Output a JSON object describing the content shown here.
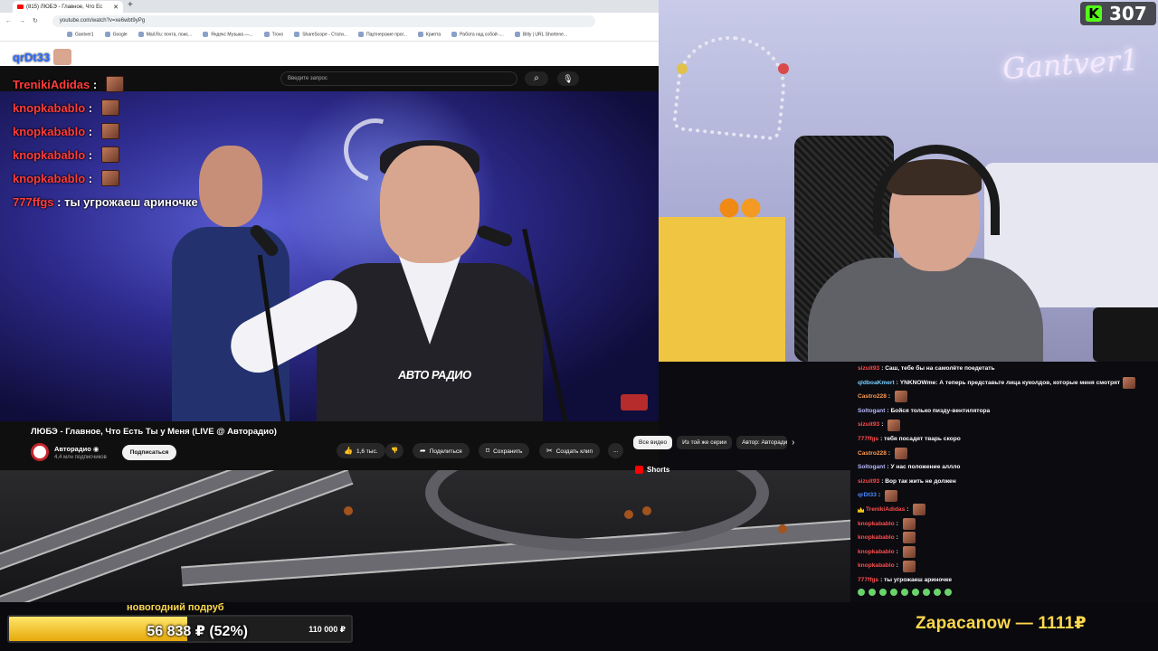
{
  "stream": {
    "viewer_count": "307",
    "streamer_neon_sign": "Gantver1"
  },
  "browser": {
    "tab_title": "(815) ЛЮБЭ - Главное, Что Ес",
    "url": "youtube.com/watch?v=xe6wbt9yPg",
    "bookmarks": [
      "Gantver1",
      "Google",
      "Mail.Ru: почта, поис...",
      "Яндекс Музыка —...",
      "Trovo",
      "ShareScope - Стати...",
      "Партнерские прог...",
      "Крипта",
      "Работа над собой -...",
      "Bitly | URL Shortene..."
    ]
  },
  "youtube": {
    "search_placeholder": "Введите запрос",
    "video_watermark": "АВТО РАДИО",
    "title": "ЛЮБЭ - Главное, Что Есть Ты у Меня (LIVE @ Авторадио)",
    "channel_name": "Авторадио",
    "channel_subs": "4,4 млн подписчиков",
    "subscribe": "Подписаться",
    "likes": "1,6 тыс.",
    "share": "Поделиться",
    "save": "Сохранить",
    "clip": "Создать клип",
    "more": "...",
    "chips": [
      "Все видео",
      "Из той же серии",
      "Автор: Авторадио"
    ],
    "shorts": "Shorts"
  },
  "overlay_chat": {
    "top_user": "qrDt33",
    "lines": [
      {
        "user": "TrenikiAdidas",
        "text": "",
        "emote": true
      },
      {
        "user": "knopkabablo",
        "text": "",
        "emote": true
      },
      {
        "user": "knopkabablo",
        "text": "",
        "emote": true
      },
      {
        "user": "knopkabablo",
        "text": "",
        "emote": true
      },
      {
        "user": "knopkabablo",
        "text": "",
        "emote": true
      },
      {
        "user": "777ffgs",
        "text": "ты угрожаеш ариночке",
        "emote": false
      }
    ]
  },
  "side_chat": [
    {
      "user": "sizuit93",
      "color": "#ff4d4d",
      "text": "Саш, тебе бы на самолёте поедетать",
      "emote": false
    },
    {
      "user": "qldboaKmert",
      "color": "#7ad0ff",
      "text": "YNKNOWme: А теперь представьте лица куколдов, которые меня смотрят",
      "emote": true
    },
    {
      "user": "Castro228",
      "color": "#ff9b4d",
      "text": "",
      "emote": true
    },
    {
      "user": "Soltogant",
      "color": "#b9b9ff",
      "text": "Бойся только пизду-вентилятора",
      "emote": false
    },
    {
      "user": "sizuit93",
      "color": "#ff4d4d",
      "text": "",
      "emote": true
    },
    {
      "user": "777ffgs",
      "color": "#ff4d4d",
      "text": "тебя посадят тварь скоро",
      "emote": false
    },
    {
      "user": "Castro228",
      "color": "#ff9b4d",
      "text": "",
      "emote": true
    },
    {
      "user": "Soltogant",
      "color": "#b9b9ff",
      "text": "У нас положение аллло",
      "emote": false
    },
    {
      "user": "sizuit93",
      "color": "#ff4d4d",
      "text": "Вор так жить не должен",
      "emote": false
    },
    {
      "user": "qrDt33",
      "color": "#4d8bff",
      "text": "",
      "emote": true
    },
    {
      "user": "TrenikiAdidas",
      "color": "#ff4d4d",
      "text": "",
      "emote": true,
      "badge": true
    },
    {
      "user": "knopkabablo",
      "color": "#ff4d4d",
      "text": "",
      "emote": true
    },
    {
      "user": "knopkabablo",
      "color": "#ff4d4d",
      "text": "",
      "emote": true
    },
    {
      "user": "knopkabablo",
      "color": "#ff4d4d",
      "text": "",
      "emote": true
    },
    {
      "user": "knopkabablo",
      "color": "#ff4d4d",
      "text": "",
      "emote": true
    },
    {
      "user": "777ffgs",
      "color": "#ff4d4d",
      "text": "ты угрожаеш ариночке",
      "emote": false
    }
  ],
  "goal": {
    "label": "новогодний подруб",
    "progress_text": "56 838 ₽ (52%)",
    "progress_fraction": 0.52,
    "target": "110 000 ₽"
  },
  "last_donation": "Zapacanow — 1111₽"
}
